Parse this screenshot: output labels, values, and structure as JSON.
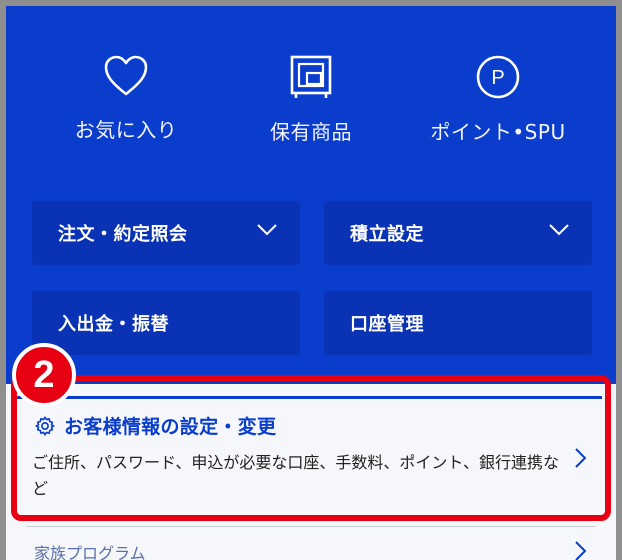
{
  "icons": [
    {
      "name": "heart-icon",
      "label": "お気に入り"
    },
    {
      "name": "holdings-icon",
      "label": "保有商品"
    },
    {
      "name": "points-icon",
      "label": "ポイント•SPU",
      "glyph": "P"
    }
  ],
  "menu": {
    "order_inquiry": "注文・約定照会",
    "accumulation": "積立設定",
    "deposit": "入出金・振替",
    "account": "口座管理"
  },
  "customer_settings": {
    "title": "お客様情報の設定・変更",
    "description": "ご住所、パスワード、申込が必要な口座、手数料、ポイント、銀行連携など"
  },
  "next_item": "家族プログラム",
  "badge": "2",
  "colors": {
    "brand_blue": "#0a3dcc",
    "tile_blue": "#0933b4",
    "highlight_red": "#e60012"
  }
}
